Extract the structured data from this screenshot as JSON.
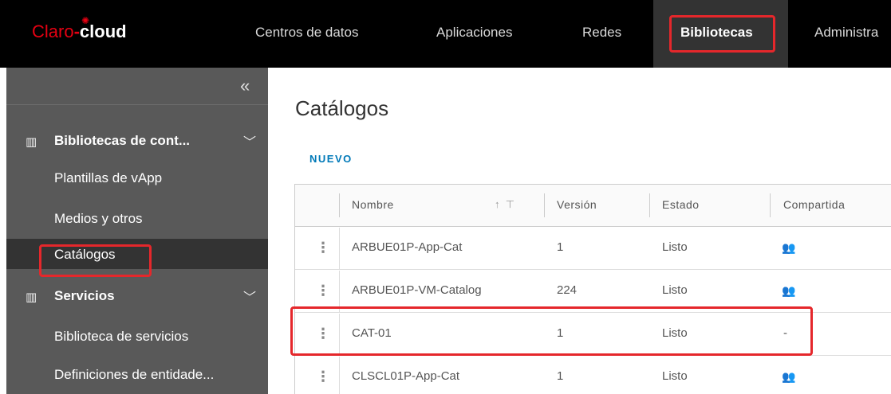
{
  "brand": {
    "claro": "Claro",
    "dash": "-",
    "cloud": "cloud"
  },
  "nav": {
    "items": [
      "Centros de datos",
      "Aplicaciones",
      "Redes",
      "Bibliotecas",
      "Administra"
    ],
    "active": "Bibliotecas"
  },
  "sidebar": {
    "collapse_glyph": "«",
    "groups": [
      {
        "label": "Bibliotecas de cont...",
        "items": [
          "Plantillas de vApp",
          "Medios y otros",
          "Catálogos"
        ]
      },
      {
        "label": "Servicios",
        "items": [
          "Biblioteca de servicios",
          "Definiciones de entidade..."
        ]
      }
    ],
    "active_item": "Catálogos"
  },
  "main": {
    "title": "Catálogos",
    "new_button": "NUEVO",
    "columns": [
      "Nombre",
      "Versión",
      "Estado",
      "Compartida"
    ],
    "rows": [
      {
        "name": "ARBUE01P-App-Cat",
        "version": "1",
        "status": "Listo",
        "shared": "shared-users-icon"
      },
      {
        "name": "ARBUE01P-VM-Catalog",
        "version": "224",
        "status": "Listo",
        "shared": "shared-users-icon"
      },
      {
        "name": "CAT-01",
        "version": "1",
        "status": "Listo",
        "shared": "-"
      },
      {
        "name": "CLSCL01P-App-Cat",
        "version": "1",
        "status": "Listo",
        "shared": "shared-users-icon"
      }
    ]
  },
  "colors": {
    "accent": "#0079b8",
    "highlight": "#e5272b",
    "brand_red": "#e60012",
    "sidebar": "#595959"
  }
}
